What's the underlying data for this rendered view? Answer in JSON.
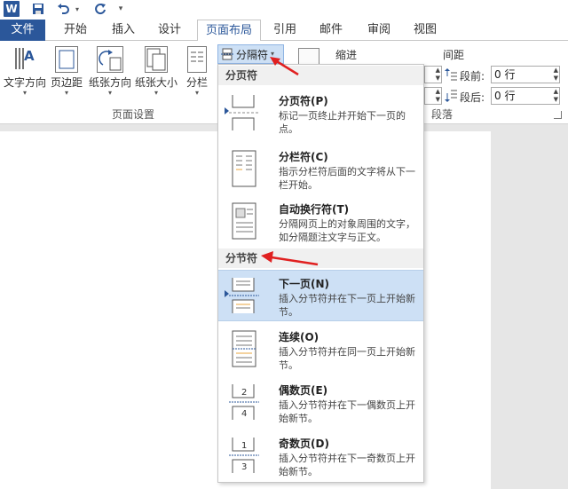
{
  "title_bar": {
    "logo_letter": "W",
    "customize_symbol": "▾"
  },
  "tabs": {
    "file": "文件",
    "home": "开始",
    "insert": "插入",
    "design": "设计",
    "layout": "页面布局",
    "references": "引用",
    "mailings": "邮件",
    "review": "审阅",
    "view": "视图"
  },
  "ribbon": {
    "text_direction": "文字方向",
    "margins": "页边距",
    "orientation": "纸张方向",
    "size": "纸张大小",
    "columns": "分栏",
    "breaks": "分隔符",
    "page_setup_group": "页面设置",
    "indent_label": "缩进",
    "spacing_label": "间距",
    "before_label": "段前:",
    "before_value": "0 行",
    "after_label": "段后:",
    "after_value": "0 行",
    "paragraph_group": "段落"
  },
  "dropdown": {
    "page_breaks_header": "分页符",
    "section_breaks_header": "分节符",
    "items": [
      {
        "title": "分页符(P)",
        "desc": "标记一页终止并开始下一页的点。"
      },
      {
        "title": "分栏符(C)",
        "desc": "指示分栏符后面的文字将从下一栏开始。"
      },
      {
        "title": "自动换行符(T)",
        "desc": "分隔网页上的对象周围的文字，如分隔题注文字与正文。"
      },
      {
        "title": "下一页(N)",
        "desc": "插入分节符并在下一页上开始新节。"
      },
      {
        "title": "连续(O)",
        "desc": "插入分节符并在同一页上开始新节。"
      },
      {
        "title": "偶数页(E)",
        "desc": "插入分节符并在下一偶数页上开始新节。"
      },
      {
        "title": "奇数页(D)",
        "desc": "插入分节符并在下一奇数页上开始新节。"
      }
    ]
  },
  "colors": {
    "accent": "#2b579a",
    "highlight": "#cde0f5",
    "annotation_arrow": "#e02020"
  }
}
